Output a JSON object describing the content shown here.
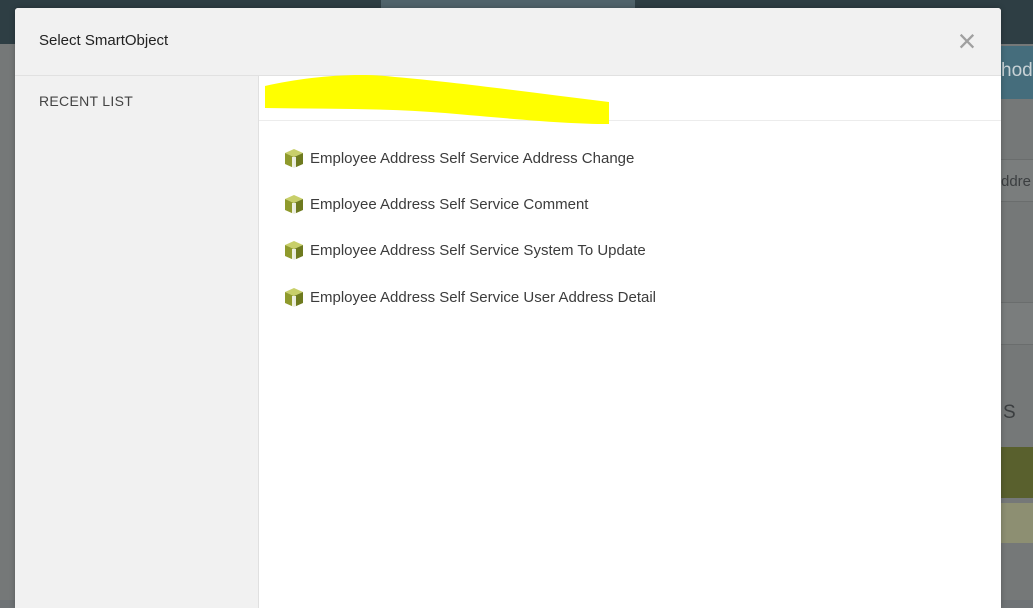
{
  "modal": {
    "title": "Select SmartObject",
    "close_label": "×"
  },
  "sidebar": {
    "items": [
      {
        "label": "RECENT LIST"
      }
    ]
  },
  "search": {
    "value": ""
  },
  "results": {
    "items": [
      {
        "label": "Employee Address Self Service Address Change",
        "icon": "smartobject-cube-icon"
      },
      {
        "label": "Employee Address Self Service Comment",
        "icon": "smartobject-cube-icon"
      },
      {
        "label": "Employee Address Self Service System To Update",
        "icon": "smartobject-cube-icon"
      },
      {
        "label": "Employee Address Self Service User Address Detail",
        "icon": "smartobject-cube-icon"
      }
    ]
  },
  "background": {
    "header_fragment": "hod",
    "row_fragment": "ddre",
    "heading_fragment": "S"
  },
  "colors": {
    "icon_olive": "#8f9a2c",
    "redaction_yellow": "#ffff00",
    "header_bg": "#f1f1f1"
  }
}
